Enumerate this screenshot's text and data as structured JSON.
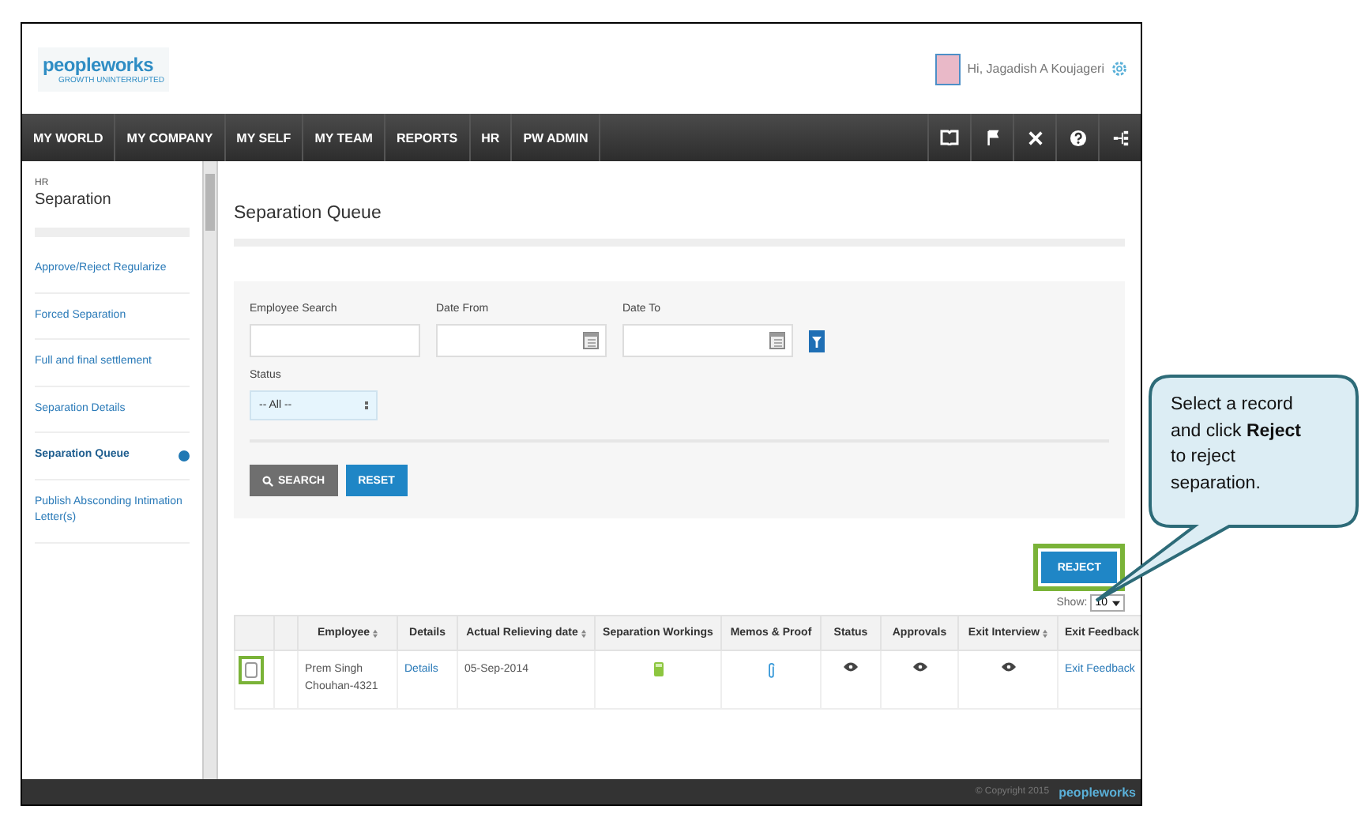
{
  "header": {
    "logo": "peopleworks",
    "tagline": "GROWTH UNINTERRUPTED",
    "greeting": "Hi, Jagadish A Koujageri"
  },
  "nav": {
    "items": [
      "MY WORLD",
      "MY COMPANY",
      "MY SELF",
      "MY TEAM",
      "REPORTS",
      "HR",
      "PW ADMIN"
    ]
  },
  "sidebar": {
    "section": "HR",
    "title": "Separation",
    "items": [
      {
        "label": "Approve/Reject Regularize",
        "selected": false
      },
      {
        "label": "Forced Separation",
        "selected": false
      },
      {
        "label": "Full and final settlement",
        "selected": false
      },
      {
        "label": "Separation Details",
        "selected": false
      },
      {
        "label": "Separation Queue",
        "selected": true
      },
      {
        "label": "Publish Absconding Intimation Letter(s)",
        "selected": false
      }
    ]
  },
  "page_title": "Separation Queue",
  "filters": {
    "fields": [
      {
        "label": "Employee Search",
        "kind": "text"
      },
      {
        "label": "Date From",
        "kind": "date"
      },
      {
        "label": "Date To",
        "kind": "date"
      }
    ],
    "status": {
      "label": "Status",
      "value": "-- All --"
    },
    "search_button": "SEARCH",
    "reset_button": "RESET"
  },
  "reject_button": "REJECT",
  "show": {
    "label": "Show:",
    "value": "10"
  },
  "table": {
    "columns": [
      {
        "sortable": false
      },
      {
        "sortable": false
      },
      {
        "label": "Employee",
        "sortable": true
      },
      {
        "label": "Details",
        "sortable": false
      },
      {
        "label": "Actual Relieving date",
        "sortable": true
      },
      {
        "label": "Separation Workings",
        "sortable": false
      },
      {
        "label": "Memos & Proof",
        "sortable": false
      },
      {
        "label": "Status",
        "sortable": false
      },
      {
        "label": "Approvals",
        "sortable": false
      },
      {
        "label": "Exit Interview",
        "sortable": true
      },
      {
        "label": "Exit Feedback",
        "sortable": false
      }
    ],
    "rows": [
      {
        "checked": false,
        "employee": "Prem Singh Chouhan-4321",
        "details": "Details",
        "relieving_date": "05-Sep-2014",
        "exit_feedback": "Exit Feedback"
      }
    ]
  },
  "footer": {
    "copyright": "© Copyright 2015",
    "logo": "peopleworks"
  },
  "callout": {
    "text": "Select a record and click **Reject** to reject separation."
  }
}
